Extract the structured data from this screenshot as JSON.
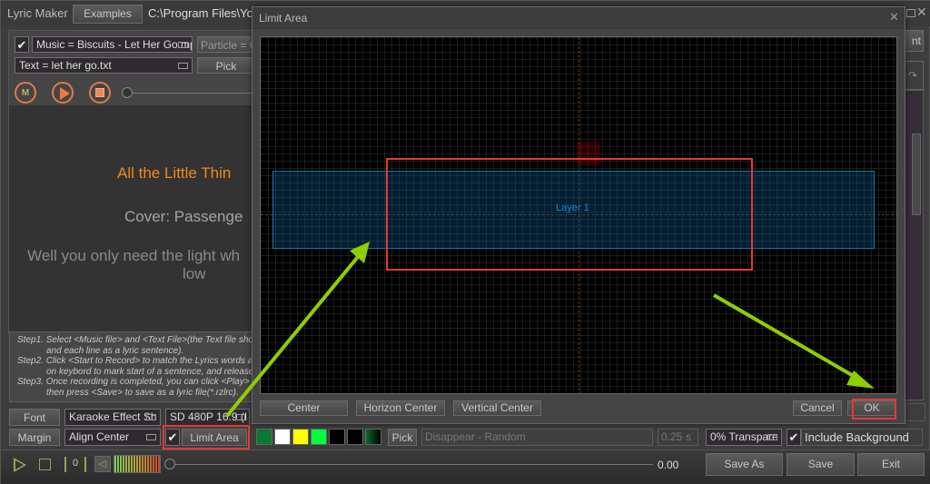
{
  "main": {
    "title": "Lyric Maker",
    "examples_button": "Examples",
    "path": "C:\\Program Files\\Youtu",
    "music_field": "Music = Biscuits - Let Her Go.mp",
    "particle_field": "Particle = Co",
    "text_field": "Text = let her go.txt",
    "pick_button": "Pick",
    "record_buttons": [
      "M",
      "play",
      "stop"
    ],
    "preview": {
      "title_line": "All the Little Thin",
      "cover_line": "Cover: Passenge",
      "lyric_line1": "Well you only need the light wh",
      "lyric_line2": "low"
    },
    "steps": [
      {
        "label": "Step1.",
        "line1": "Select <Music file> and <Text File>(the Text file shou",
        "line2": "and each line as a lyric sentence)."
      },
      {
        "label": "Step2.",
        "line1": "Click <Start to Record> to match the Lyrics words ar",
        "line2": "on keybord to mark start of a sentence, and release"
      },
      {
        "label": "Step3.",
        "line1": "Once recording is completed, you can click <Play> t",
        "line2": "then press <Save> to save as a lyric file(*.rzlrc)."
      }
    ],
    "font_button": "Font",
    "effect_dropdown": "Karaoke Effect Sh",
    "resolution_dropdown": "SD 480P 16:9 (I",
    "margin_button": "Margin",
    "align_dropdown": "Align Center",
    "limit_area_checked": true,
    "limit_area_button": "Limit Area",
    "swatches": [
      "#0a7a35",
      "#ffffff",
      "#ffff00",
      "#00ff3c",
      "#000000",
      "#000000",
      "#0b6a2e"
    ],
    "pick2_button": "Pick",
    "effect_field": "Disappear - Random",
    "duration_value": "0.25",
    "duration_unit": "s",
    "transparency_dropdown": "0% Transpare",
    "include_background_checked": true,
    "include_background_label": "Include Background",
    "playback": {
      "counter_value": "0",
      "time": "0.00",
      "volume_level": 1.0,
      "progress": 0
    },
    "save_as_button": "Save As",
    "save_button": "Save",
    "exit_button": "Exit",
    "right_partial_button": "nt"
  },
  "dialog": {
    "title": "Limit Area",
    "layer_label": "Layer 1",
    "center_button": "Center",
    "horizon_center_button": "Horizon Center",
    "vertical_center_button": "Vertical Center",
    "cancel_button": "Cancel",
    "ok_button": "OK"
  },
  "annotations": {
    "highlight_color": "#e53935",
    "arrow_color": "#8fce00"
  }
}
